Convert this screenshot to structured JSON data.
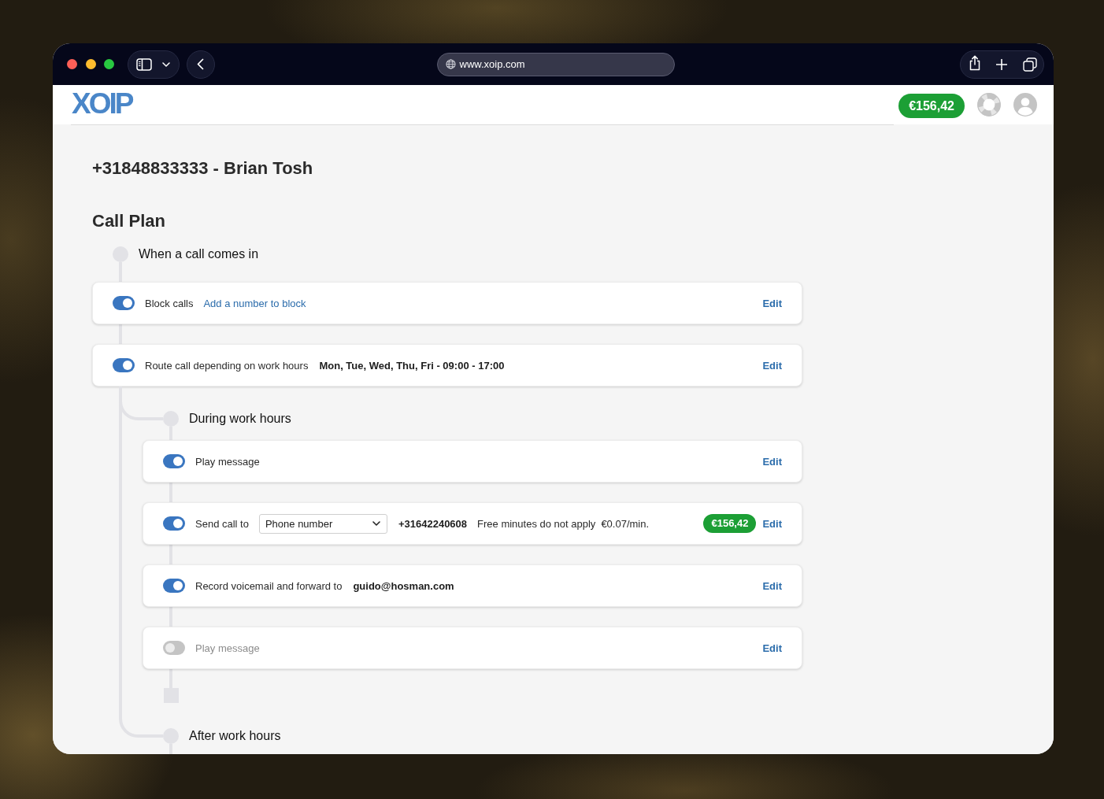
{
  "browser": {
    "url": "www.xoip.com"
  },
  "header": {
    "logo": "XOIP",
    "balance": "€156,42"
  },
  "page": {
    "title": "+31848833333 - Brian Tosh",
    "section_title": "Call Plan"
  },
  "call_plan": {
    "trigger": "When a call comes in",
    "steps": [
      {
        "kind": "link",
        "on": true,
        "label": "Block calls",
        "link": "Add a number to block",
        "action": "Edit"
      },
      {
        "kind": "detail",
        "on": true,
        "label": "Route call depending on work hours",
        "detail": "Mon, Tue, Wed, Thu, Fri - 09:00 - 17:00",
        "action": "Edit"
      }
    ],
    "branches": [
      {
        "title": "During work hours",
        "steps": [
          {
            "kind": "plain",
            "on": true,
            "label": "Play message",
            "action": "Edit"
          },
          {
            "kind": "forward",
            "on": true,
            "label": "Send call to",
            "select": "Phone number",
            "detail": "+31642240608",
            "note": "Free minutes do not apply",
            "rate": "€0.07/min.",
            "badge": "€156,42",
            "action": "Edit"
          },
          {
            "kind": "detail",
            "on": true,
            "label": "Record voicemail and forward to",
            "detail": "guido@hosman.com",
            "action": "Edit"
          },
          {
            "kind": "plain",
            "on": false,
            "label": "Play message",
            "action": "Edit"
          }
        ]
      },
      {
        "title": "After work hours"
      }
    ]
  }
}
